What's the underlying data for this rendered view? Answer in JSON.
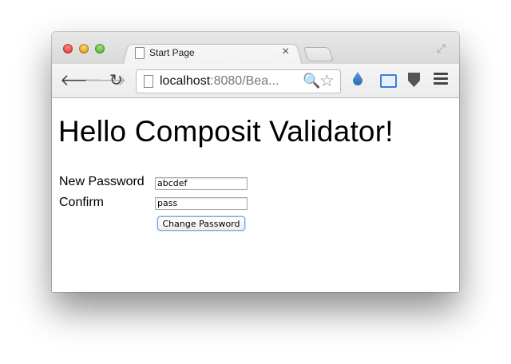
{
  "browser": {
    "tab_title": "Start Page",
    "tab_close": "×",
    "url_host": "localhost",
    "url_rest": ":8080/Bea...",
    "back_glyph": "🡐",
    "forward_glyph": "🡒",
    "reload_glyph": "↻",
    "search_glyph": "🔍",
    "star_glyph": "☆",
    "fullscreen_glyph": "⤢"
  },
  "page": {
    "title": "Hello Composit Validator!",
    "new_password_label": "New Password",
    "confirm_label": "Confirm",
    "new_password_value": "abcdef",
    "confirm_value": "pass",
    "change_button_label": "Change Password"
  },
  "colors": {
    "focus_ring": "#7aa7e9",
    "ext_drop": "#2c6ab0",
    "ext_cast": "#3b7fd4",
    "ext_shield": "#555555"
  }
}
